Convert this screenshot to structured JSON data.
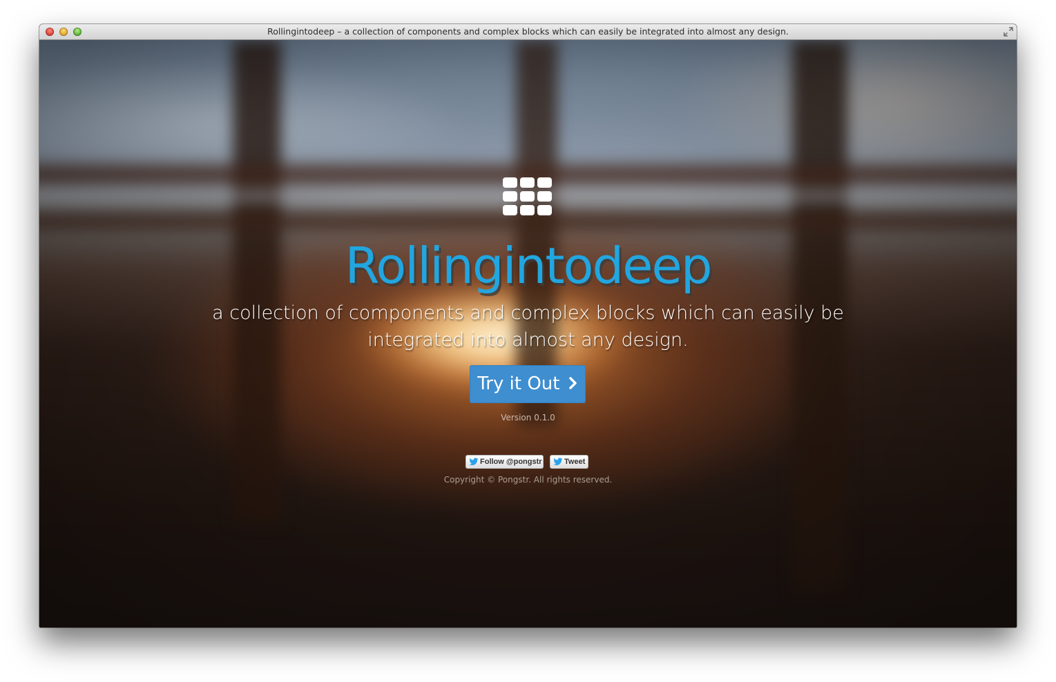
{
  "window": {
    "title": "Rollingintodeep – a collection of components and complex blocks which can easily be integrated into almost any design."
  },
  "hero": {
    "logo_icon": "grid-icon",
    "brand": "Rollingintodeep",
    "tagline": "a collection of components and complex blocks which can easily be integrated into almost any design.",
    "cta_label": "Try it Out",
    "cta_icon": "chevron-right-icon",
    "version": "Version 0.1.0"
  },
  "social": {
    "follow_label": "Follow @pongstr",
    "tweet_label": "Tweet",
    "icon": "twitter-bird-icon"
  },
  "footer": {
    "copyright": "Copyright © Pongstr. All rights reserved."
  },
  "colors": {
    "brand": "#22a6e0",
    "cta": "#3e8ed0"
  }
}
